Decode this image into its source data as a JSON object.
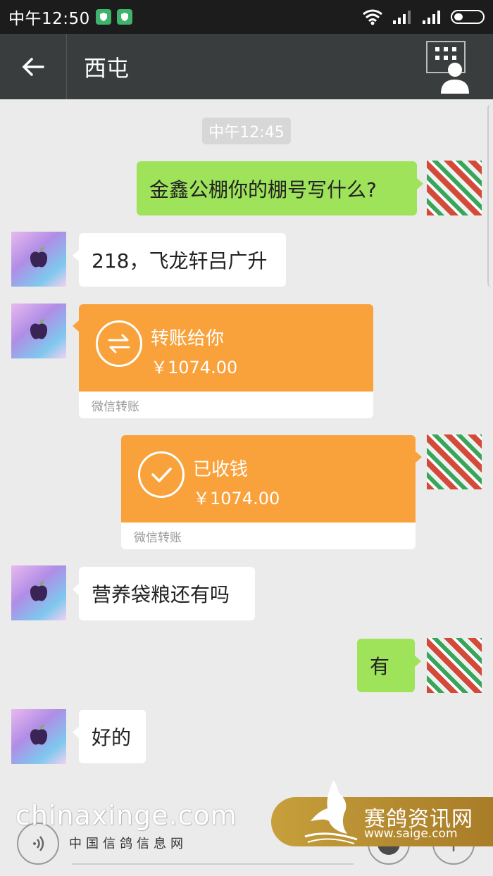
{
  "status_bar": {
    "time": "中午12:50"
  },
  "header": {
    "title": "西屯"
  },
  "conversation": {
    "timestamp": "中午12:45",
    "messages": [
      {
        "sender": "me",
        "type": "text",
        "text": "金鑫公棚你的棚号写什么?"
      },
      {
        "sender": "them",
        "type": "text",
        "text": "218，飞龙轩吕广升"
      },
      {
        "sender": "them",
        "type": "transfer",
        "title": "转账给你",
        "amount": "￥1074.00",
        "footer": "微信转账",
        "icon": "transfer-arrows-icon"
      },
      {
        "sender": "me",
        "type": "transfer",
        "title": "已收钱",
        "amount": "￥1074.00",
        "footer": "微信转账",
        "icon": "checkmark-icon"
      },
      {
        "sender": "them",
        "type": "text",
        "text": "营养袋粮还有吗"
      },
      {
        "sender": "me",
        "type": "text",
        "text": "有"
      },
      {
        "sender": "them",
        "type": "text",
        "text": "好的"
      }
    ]
  },
  "watermarks": {
    "site_main": "chinaxinge.com",
    "site_sub": "中国信鸽信息网",
    "logo_cn": "赛鸽资讯网",
    "logo_url": "www.saige.com"
  },
  "colors": {
    "background": "#ebebeb",
    "header": "#3a3d3e",
    "my_bubble": "#9ee35a",
    "their_bubble": "#ffffff",
    "transfer": "#f9a23c"
  }
}
